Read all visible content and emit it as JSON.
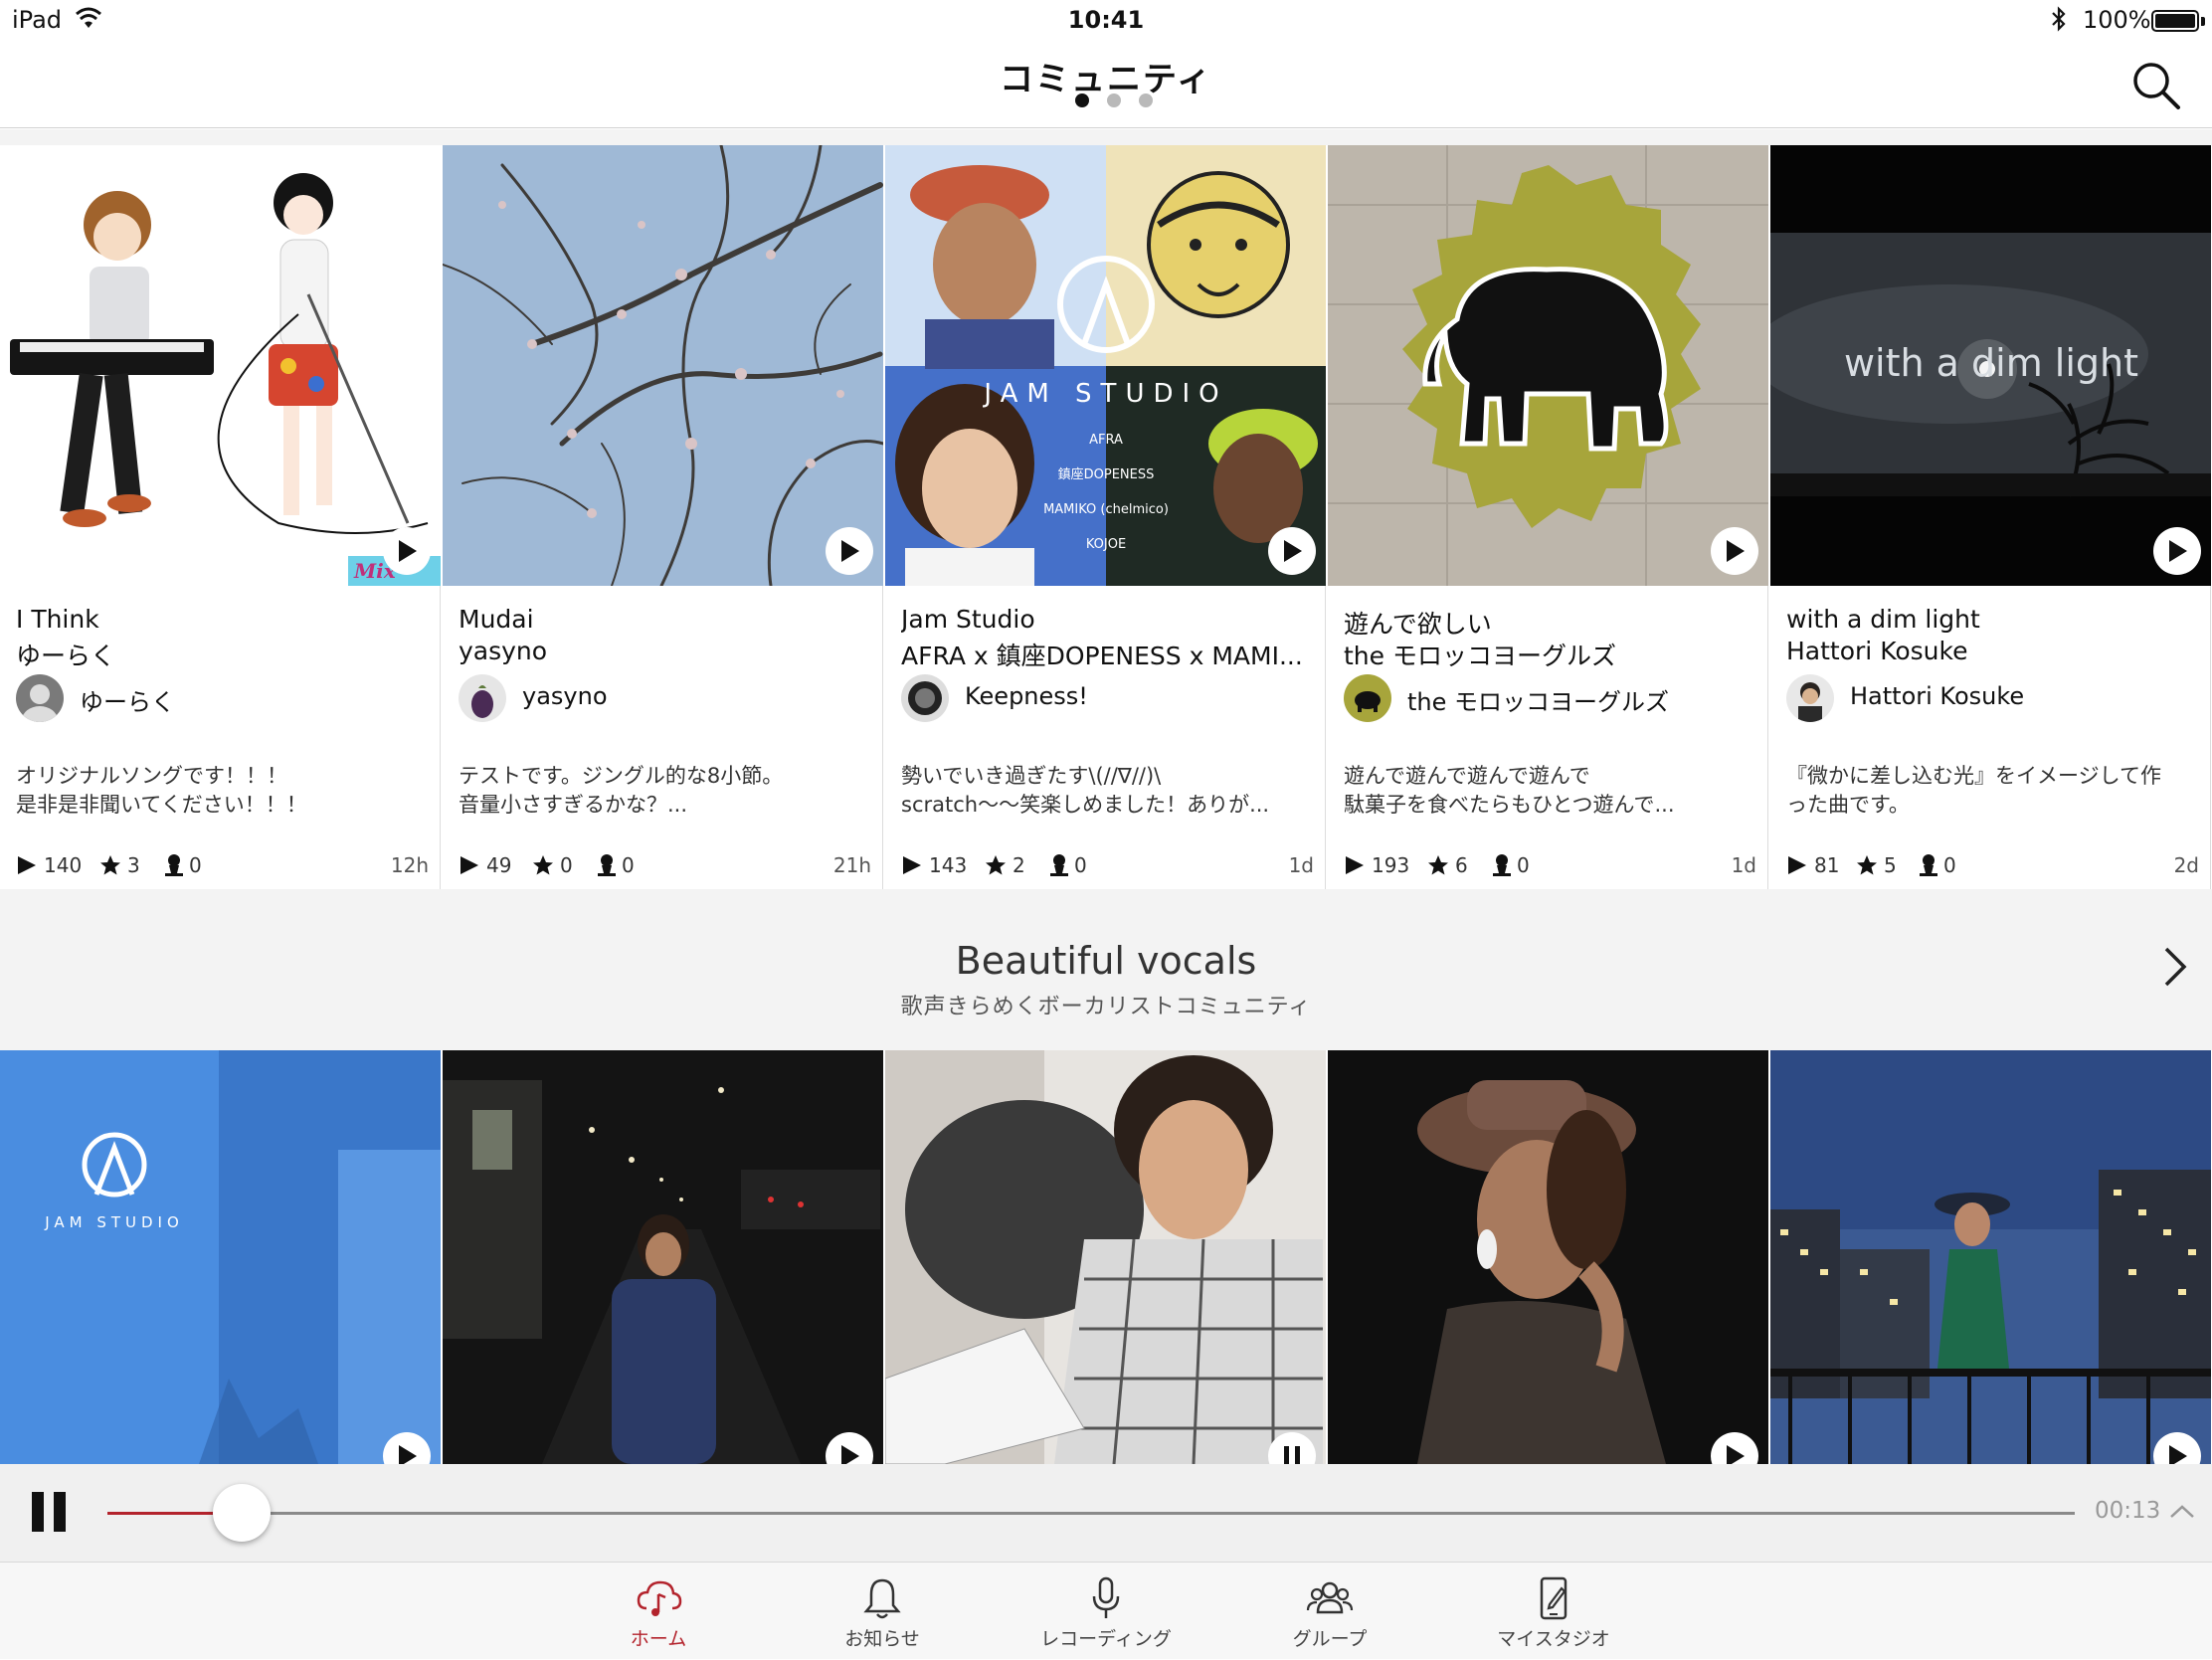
{
  "status_bar": {
    "device": "iPad",
    "time": "10:41",
    "battery": "100%"
  },
  "nav": {
    "title": "コミュニティ",
    "page_count": 3,
    "active_page": 1
  },
  "cards": [
    {
      "title": "I Think",
      "subtitle": "ゆーらく",
      "user": "ゆーらく",
      "desc_line1": "オリジナルソングです！！！",
      "desc_line2": "是非是非聞いてください！！！",
      "plays": "140",
      "stars": "3",
      "members": "0",
      "age": "12h"
    },
    {
      "title": "Mudai",
      "subtitle": "yasyno",
      "user": "yasyno",
      "desc_line1": "テストです。ジングル的な8小節。",
      "desc_line2": "音量小さすぎるかな？...",
      "plays": "49",
      "stars": "0",
      "members": "0",
      "age": "21h"
    },
    {
      "title": "Jam Studio",
      "subtitle": "AFRA x 鎮座DOPENESS x MAMI...",
      "user": "Keepness!",
      "desc_line1": "勢いでいき過ぎたす\\(//∇//)\\",
      "desc_line2": "scratch〜〜笑楽しめました！ありが...",
      "plays": "143",
      "stars": "2",
      "members": "0",
      "age": "1d"
    },
    {
      "title": "遊んで欲しい",
      "subtitle": "the モロッコヨーグルズ",
      "user": "the モロッコヨーグルズ",
      "desc_line1": "遊んで遊んで遊んで遊んで",
      "desc_line2": "駄菓子を食べたらもひとつ遊んで...",
      "plays": "193",
      "stars": "6",
      "members": "0",
      "age": "1d"
    },
    {
      "title": "with a dim light",
      "subtitle": "Hattori Kosuke",
      "user": "Hattori Kosuke",
      "desc_line1": "『微かに差し込む光』をイメージして作",
      "desc_line2": "った曲です。",
      "plays": "81",
      "stars": "5",
      "members": "0",
      "age": "2d"
    }
  ],
  "artwork_text": {
    "jam_studio_logo": "JAM STUDIO",
    "jam_names": [
      "AFRA",
      "鎮座DOPENESS",
      "MAMIKO (chelmico)",
      "KOJOE"
    ],
    "dim_light": "with a dim light",
    "mixed_tag": "Mix"
  },
  "section": {
    "title": "Beautiful vocals",
    "subtitle": "歌声きらめくボーカリストコミュニティ"
  },
  "player": {
    "time": "00:13",
    "progress": 0.068
  },
  "tabs": [
    {
      "label": "ホーム",
      "icon": "cloud-music-icon",
      "active": true
    },
    {
      "label": "お知らせ",
      "icon": "bell-icon",
      "active": false
    },
    {
      "label": "レコーディング",
      "icon": "microphone-icon",
      "active": false
    },
    {
      "label": "グループ",
      "icon": "group-icon",
      "active": false
    },
    {
      "label": "マイスタジオ",
      "icon": "phone-edit-icon",
      "active": false
    }
  ],
  "colors": {
    "accent": "#b3232c",
    "section_bg": "#f3f3f3"
  }
}
